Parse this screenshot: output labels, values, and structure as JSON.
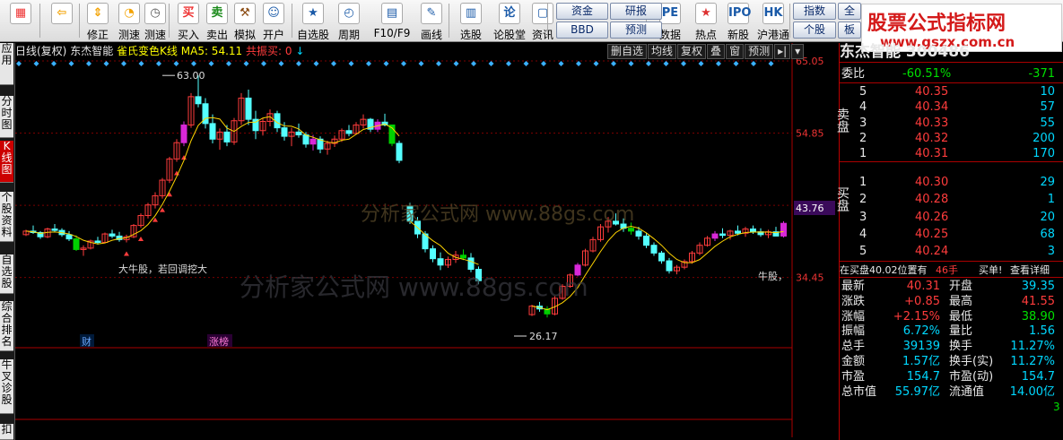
{
  "toolbar": {
    "buttons": [
      {
        "label": "",
        "icon": "grid-icon"
      },
      {
        "label": "",
        "icon": "back-arrow-icon"
      },
      {
        "label": "修正",
        "icon": "up-down-arrows-icon"
      },
      {
        "label": "测速",
        "icon": "speed-test-icon"
      },
      {
        "label": "测速",
        "icon": "clock-icon"
      },
      {
        "label": "买入",
        "icon": "buy-icon"
      },
      {
        "label": "卖出",
        "icon": "sell-icon"
      },
      {
        "label": "模拟",
        "icon": "gavel-icon"
      },
      {
        "label": "开户",
        "icon": "person-icon"
      },
      {
        "label": "自选股",
        "icon": "star-folder-icon"
      },
      {
        "label": "周期",
        "icon": "clock-period-icon"
      },
      {
        "label": "F10/F9",
        "icon": "f10-icon"
      },
      {
        "label": "画线",
        "icon": "pencil-icon"
      },
      {
        "label": "选股",
        "icon": "select-stock-icon"
      },
      {
        "label": "论股堂",
        "icon": "forum-icon"
      },
      {
        "label": "资讯",
        "icon": "news-icon"
      },
      {
        "label": "数据",
        "icon": "pe-data-icon"
      },
      {
        "label": "热点",
        "icon": "hot-icon"
      },
      {
        "label": "新股",
        "icon": "ipo-icon"
      },
      {
        "label": "沪港通",
        "icon": "sse-hke-icon"
      }
    ],
    "small_buttons": [
      "资金",
      "研报",
      "BBD",
      "预测",
      "指数",
      "个股",
      "全",
      "板"
    ],
    "gutter_icons": [
      "pull-down-icon",
      "pull-up-icon"
    ]
  },
  "logo": {
    "title": "股票公式指标网",
    "url": "www.gszx.com.cn"
  },
  "left_tabs": [
    "应用",
    "分时图",
    "K线图",
    "个股资料",
    "自选股",
    "综合排名",
    "牛叉诊股",
    "扣"
  ],
  "chart_header": {
    "period": "日线(复权)",
    "stock_name": "东杰智能",
    "indicator": "雀氏变色K线",
    "ma5": "MA5: 54.11",
    "signal": "共振买: 0"
  },
  "chart_buttons": [
    "删自选",
    "均线",
    "复权",
    "叠",
    "窗",
    "预测"
  ],
  "chart_annotations": {
    "high_label": "63.00",
    "low_label": "26.17",
    "note": "大牛股，若回调挖大",
    "note_right": "牛股，",
    "badge_cai": "财",
    "badge_zhang": "涨榜",
    "watermark1": "分析家公式网 www.88gs.com",
    "watermark2": "分析家公式网 www.88gs.com"
  },
  "panel": {
    "title": "东杰智能 300486",
    "weibi_label": "委比",
    "weibi_value": "-60.51%",
    "weibi_diff": "-371",
    "sell_label": "卖盘",
    "buy_label": "买盘",
    "sell": [
      {
        "level": "5",
        "price": "40.35",
        "vol": "10"
      },
      {
        "level": "4",
        "price": "40.34",
        "vol": "57"
      },
      {
        "level": "3",
        "price": "40.33",
        "vol": "55"
      },
      {
        "level": "2",
        "price": "40.32",
        "vol": "200"
      },
      {
        "level": "1",
        "price": "40.31",
        "vol": "170"
      }
    ],
    "buy": [
      {
        "level": "1",
        "price": "40.30",
        "vol": "29"
      },
      {
        "level": "2",
        "price": "40.28",
        "vol": "1"
      },
      {
        "level": "3",
        "price": "40.26",
        "vol": "20"
      },
      {
        "level": "4",
        "price": "40.25",
        "vol": "68"
      },
      {
        "level": "5",
        "price": "40.24",
        "vol": "3"
      }
    ],
    "inbook_text": "在买盘40.02位置有",
    "inbook_hands": "46手",
    "inbook_buy": "买单!",
    "inbook_detail": "查看详细",
    "stats": [
      [
        "最新",
        "40.31",
        "开盘",
        "39.35"
      ],
      [
        "涨跌",
        "+0.85",
        "最高",
        "41.55"
      ],
      [
        "涨幅",
        "+2.15%",
        "最低",
        "38.90"
      ],
      [
        "振幅",
        "6.72%",
        "量比",
        "1.56"
      ],
      [
        "总手",
        "39139",
        "换手",
        "11.27%"
      ],
      [
        "金额",
        "1.57亿",
        "换手(实)",
        "11.27%"
      ],
      [
        "市盈",
        "154.7",
        "市盈(动)",
        "154.7"
      ],
      [
        "总市值",
        "55.97亿",
        "流通值",
        "14.00亿"
      ]
    ],
    "corner_digit": "3"
  },
  "chart_data": {
    "type": "candlestick",
    "y_ticks": [
      "65.05",
      "54.85",
      "44.65",
      "34.45"
    ],
    "current_price_tag": "43.76",
    "high": 63.0,
    "low": 26.17,
    "candles": [
      [
        40.5,
        41.2,
        40.3,
        41.0
      ],
      [
        41.0,
        41.8,
        40.6,
        40.8
      ],
      [
        40.8,
        41.0,
        39.9,
        40.2
      ],
      [
        40.2,
        41.5,
        40.0,
        41.3
      ],
      [
        41.3,
        42.0,
        40.9,
        41.1
      ],
      [
        41.1,
        41.4,
        40.2,
        40.5
      ],
      [
        40.5,
        41.0,
        39.6,
        39.9
      ],
      [
        39.9,
        40.4,
        38.2,
        38.4
      ],
      [
        38.4,
        39.0,
        37.5,
        38.6
      ],
      [
        38.6,
        39.8,
        38.4,
        39.6
      ],
      [
        39.6,
        40.2,
        39.1,
        39.4
      ],
      [
        39.4,
        40.8,
        39.3,
        40.6
      ],
      [
        40.6,
        41.2,
        40.0,
        40.3
      ],
      [
        40.3,
        40.9,
        39.5,
        39.8
      ],
      [
        39.8,
        40.5,
        39.4,
        40.2
      ],
      [
        40.2,
        42.0,
        40.0,
        41.8
      ],
      [
        41.8,
        43.5,
        41.5,
        43.2
      ],
      [
        43.2,
        45.0,
        42.8,
        44.7
      ],
      [
        44.7,
        46.5,
        44.2,
        46.0
      ],
      [
        46.0,
        48.5,
        45.6,
        48.2
      ],
      [
        48.2,
        51.5,
        47.8,
        51.2
      ],
      [
        51.2,
        54.0,
        50.8,
        53.5
      ],
      [
        53.5,
        56.5,
        53.0,
        56.0
      ],
      [
        56.0,
        60.5,
        55.6,
        60.0
      ],
      [
        60.0,
        63.0,
        58.5,
        59.0
      ],
      [
        59.0,
        59.8,
        55.5,
        56.2
      ],
      [
        56.2,
        57.5,
        53.4,
        54.0
      ],
      [
        54.0,
        55.5,
        52.5,
        55.0
      ],
      [
        55.0,
        56.0,
        53.0,
        53.6
      ],
      [
        53.6,
        57.0,
        53.2,
        56.6
      ],
      [
        56.6,
        60.5,
        56.0,
        59.8
      ],
      [
        59.8,
        61.0,
        56.0,
        56.8
      ],
      [
        56.8,
        58.0,
        54.0,
        55.2
      ],
      [
        55.2,
        57.0,
        54.5,
        56.5
      ],
      [
        56.5,
        58.2,
        55.8,
        57.6
      ],
      [
        57.6,
        58.0,
        55.0,
        55.6
      ],
      [
        55.6,
        56.4,
        53.8,
        54.4
      ],
      [
        54.4,
        55.6,
        53.0,
        55.0
      ],
      [
        55.0,
        56.2,
        54.2,
        54.6
      ],
      [
        54.6,
        55.0,
        52.8,
        53.3
      ],
      [
        53.3,
        54.6,
        52.4,
        54.0
      ],
      [
        54.0,
        54.4,
        52.0,
        52.6
      ],
      [
        52.6,
        53.8,
        51.8,
        53.4
      ],
      [
        53.4,
        54.5,
        52.9,
        54.0
      ],
      [
        54.0,
        55.5,
        53.6,
        55.2
      ],
      [
        55.2,
        56.0,
        54.4,
        54.8
      ],
      [
        54.8,
        56.4,
        54.6,
        56.0
      ],
      [
        56.0,
        57.5,
        55.5,
        56.8
      ],
      [
        56.8,
        57.0,
        55.0,
        55.4
      ],
      [
        55.4,
        56.8,
        55.0,
        56.4
      ],
      [
        56.4,
        57.6,
        55.8,
        56.0
      ],
      [
        56.0,
        55.8,
        53.0,
        53.4
      ],
      [
        53.4,
        53.8,
        50.6,
        51.0
      ]
    ],
    "candles2": [
      [
        44.5,
        45.0,
        42.0,
        42.4
      ],
      [
        42.4,
        43.0,
        40.0,
        40.6
      ],
      [
        40.6,
        41.0,
        38.0,
        38.5
      ],
      [
        38.5,
        39.0,
        36.6,
        37.1
      ],
      [
        37.1,
        38.0,
        35.5,
        36.2
      ],
      [
        36.2,
        37.4,
        35.8,
        37.0
      ],
      [
        37.0,
        38.2,
        36.5,
        37.6
      ],
      [
        37.6,
        38.4,
        36.9,
        37.2
      ],
      [
        37.2,
        37.9,
        35.2,
        35.6
      ],
      [
        35.6,
        36.0,
        33.5,
        34.0
      ],
      [
        34.0,
        34.5,
        31.8,
        32.2
      ],
      [
        32.2,
        32.8,
        30.5,
        31.0
      ],
      [
        31.0,
        31.5,
        29.2,
        29.6
      ],
      [
        29.6,
        30.0,
        27.5,
        28.0
      ],
      [
        28.0,
        28.8,
        26.17,
        28.4
      ],
      [
        28.4,
        29.5,
        28.0,
        29.2
      ],
      [
        29.2,
        30.6,
        29.0,
        30.4
      ],
      [
        30.4,
        31.0,
        29.6,
        30.0
      ],
      [
        30.0,
        30.4,
        28.8,
        29.3
      ],
      [
        29.3,
        31.8,
        29.1,
        31.5
      ],
      [
        31.5,
        33.5,
        31.3,
        33.2
      ],
      [
        33.2,
        35.0,
        33.0,
        34.8
      ],
      [
        34.8,
        36.5,
        34.6,
        36.2
      ],
      [
        36.2,
        38.5,
        36.0,
        38.2
      ],
      [
        38.2,
        40.2,
        38.0,
        39.8
      ],
      [
        39.8,
        42.0,
        39.5,
        41.6
      ],
      [
        41.6,
        43.0,
        40.8,
        42.4
      ],
      [
        42.4,
        43.5,
        41.8,
        42.0
      ],
      [
        42.0,
        42.8,
        40.9,
        41.4
      ],
      [
        41.4,
        42.2,
        40.5,
        41.0
      ],
      [
        41.0,
        41.6,
        39.8,
        40.3
      ],
      [
        40.3,
        40.8,
        38.6,
        39.0
      ],
      [
        39.0,
        39.4,
        37.5,
        37.9
      ],
      [
        37.9,
        38.2,
        36.4,
        36.8
      ],
      [
        36.8,
        37.2,
        35.0,
        35.4
      ],
      [
        35.4,
        36.2,
        34.9,
        35.9
      ],
      [
        35.9,
        37.0,
        35.6,
        36.7
      ],
      [
        36.7,
        38.2,
        36.4,
        37.9
      ],
      [
        37.9,
        39.4,
        37.6,
        39.0
      ],
      [
        39.0,
        40.3,
        38.8,
        40.0
      ],
      [
        40.0,
        41.0,
        39.6,
        40.6
      ],
      [
        40.6,
        41.4,
        40.0,
        40.4
      ],
      [
        40.4,
        41.2,
        39.8,
        41.0
      ],
      [
        41.0,
        41.8,
        40.4,
        40.7
      ],
      [
        40.7,
        41.6,
        40.2,
        41.3
      ],
      [
        41.3,
        41.8,
        40.6,
        40.9
      ],
      [
        40.9,
        41.4,
        40.2,
        40.5
      ],
      [
        40.5,
        41.2,
        40.0,
        40.9
      ],
      [
        40.9,
        41.6,
        40.5,
        40.3
      ],
      [
        40.3,
        42.4,
        40.1,
        42.1
      ]
    ]
  }
}
